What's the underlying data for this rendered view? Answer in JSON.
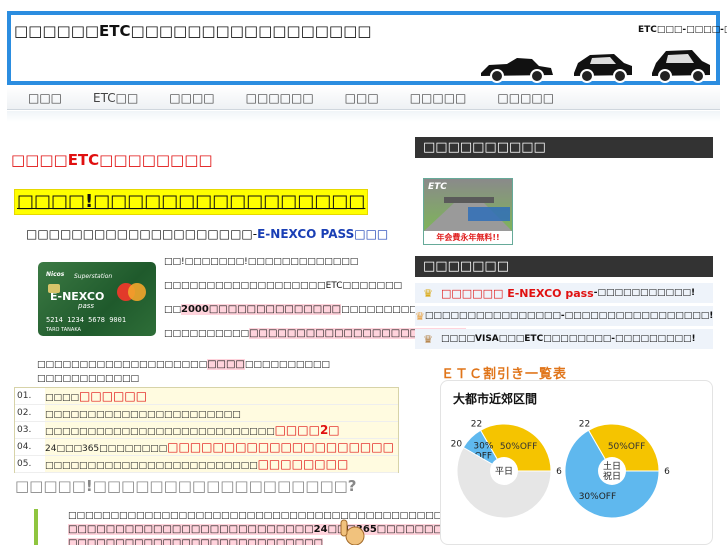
{
  "header": {
    "site_title": "□□□□□□ETC□□□□□□□□□□□□□□□□□",
    "tagline": "ETC□□□-□□□□-□□□"
  },
  "nav": {
    "items": [
      "□□□",
      "ETC□□",
      "□□□□",
      "□□□□□□",
      "□□□",
      "□□□□□",
      "□□□□□"
    ]
  },
  "main": {
    "heading": "□□□□ETC□□□□□□□□",
    "highlight_title": "□□□□!□□□□□□□□□□□□□□□□",
    "card_intro_prefix": "□□□□□□□□□□□□□□□□□□□□-",
    "card_intro_brand": "E-NEXCO PASS□□□",
    "card_para1": "□□!□□□□□□□!□□□□□□□□□□□□□",
    "card_para2": "□□□□□□□□□□□□□□□□□□□ETC□□□□□□□",
    "card_para3_prefix": "□□",
    "card_para3_mark": "2000□□□□□□□□□□□□□□",
    "card_para3_suffix": "□□□□□□□□□□□□□□□□□□□□",
    "card_para4_prefix": "□□□□□□□□□□",
    "card_para4_mark": "□□□□□□□□□□□□□□□□□□□□□□□",
    "card_note_prefix": "□□□□□□□□□□□□□□□□□□□□",
    "card_note_mark": "□□□□",
    "card_note_suffix": "□□□□□□□□□□",
    "card_note_line2": "□□□□□□□□□□□□",
    "points": [
      {
        "num": "01.",
        "text": "□□□□",
        "red": "□□□□□□"
      },
      {
        "num": "02.",
        "text": "□□□□□□□□□□□□□□□□□□□□□□□",
        "red": ""
      },
      {
        "num": "03.",
        "text": "□□□□□□□□□□□□□□□□□□□□□□□□□□□",
        "red": "□□□□2□"
      },
      {
        "num": "04.",
        "text": "24□□□365□□□□□□□□",
        "red": "□□□□□□□□□□□□□□□□□□□□"
      },
      {
        "num": "05.",
        "text": "□□□□□□□□□□□□□□□□□□□□□□□□□",
        "red": "□□□□□□□□"
      }
    ],
    "question": "□□□□□!□□□□□□□□□□□□□□□□□□?",
    "body_line1": "□□□□□□□□□□□□□□□□□□□□□□□□□□□□□□□□□□□□□□□□□□□□□□□",
    "body_line2": "□□□□□□□□□□□□□□□□□□□□□□□□□□24□□□365□□□□□□□",
    "body_line3": "□□□□□□□□□□□□□□□□□□□□□□□□□□□"
  },
  "sidebar": {
    "head1": "□□□□□□□□□□",
    "banner_logo": "ETC",
    "banner_foot": "年会費永年無料!!",
    "head2": "□□□□□□□",
    "ranking": [
      {
        "main": "□□□□□□ E-NEXCO pass",
        "tail": "-□□□□□□□□□□□!"
      },
      {
        "main": "",
        "tail": "□□□□□□□□□□□□□□□□-□□□□□□□□□□□□□□□□□!"
      },
      {
        "main": "",
        "tail": "□□□□VISA□□□ETC□□□□□□□□-□□□□□□□□□!"
      }
    ],
    "discount_heading": "ＥＴＣ割引き一覧表",
    "region_label": "大都市近郊区間"
  },
  "colors": {
    "header_border": "#2b8de0",
    "accent_red": "#e01010",
    "pie_yellow": "#f5c400",
    "pie_blue": "#5fb8ee",
    "pie_gray": "#e6e6e6"
  },
  "chart_data": [
    {
      "type": "pie",
      "title": "平日",
      "slices": [
        {
          "label": "50%OFF",
          "from": 22,
          "to": 6,
          "color": "#f5c400"
        },
        {
          "label": "30%\nOFF",
          "from": 20,
          "to": 22,
          "color": "#5fb8ee"
        },
        {
          "label": "",
          "from": 6,
          "to": 20,
          "color": "#e6e6e6"
        }
      ],
      "hour_labels": [
        "22",
        "20",
        "6"
      ]
    },
    {
      "type": "pie",
      "title": "土日\n祝日",
      "slices": [
        {
          "label": "50%OFF",
          "from": 22,
          "to": 6,
          "color": "#f5c400"
        },
        {
          "label": "30%OFF",
          "from": 6,
          "to": 22,
          "color": "#5fb8ee"
        }
      ],
      "hour_labels": [
        "22",
        "6"
      ]
    }
  ]
}
